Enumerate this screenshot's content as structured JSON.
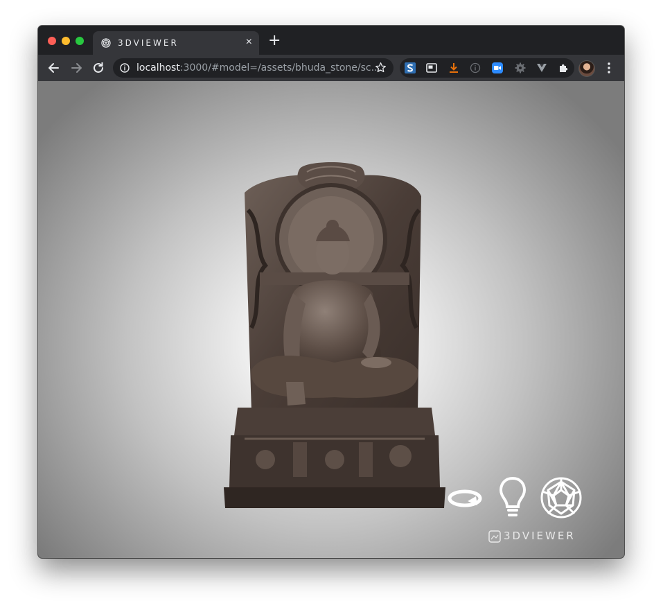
{
  "browser": {
    "tab": {
      "title": "3DVIEWER",
      "favicon": "3dviewer-logo-icon",
      "close_icon": "×"
    },
    "new_tab_label": "+",
    "url": {
      "host": "localhost",
      "path": ":3000/#model=/assets/bhuda_stone/sc..."
    },
    "extensions": [
      "s-extension-icon",
      "picture-in-picture-icon",
      "download-icon",
      "info-icon",
      "zoom-icon",
      "settings-gear-icon",
      "vuejs-devtools-icon",
      "extensions-puzzle-icon"
    ],
    "colors": {
      "tabbar": "#202124",
      "toolbar": "#35363a",
      "text": "#e8eaed",
      "download": "#e8710a",
      "zoom": "#2d8cff"
    }
  },
  "viewer": {
    "model_name": "bhuda_stone",
    "controls": [
      "auto-rotate-icon",
      "lighting-bulb-icon",
      "wireframe-icon"
    ],
    "brand": {
      "text": "3DVIEWER"
    }
  }
}
